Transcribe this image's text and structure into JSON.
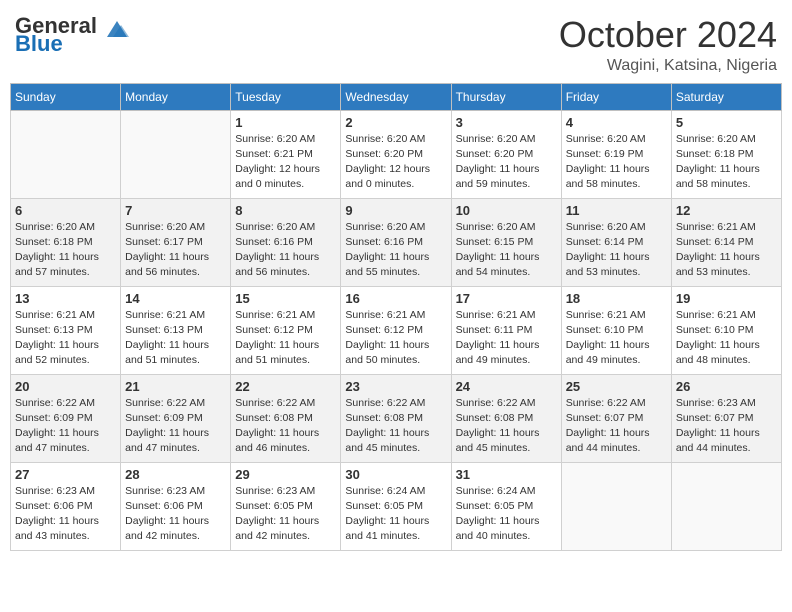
{
  "header": {
    "logo_line1": "General",
    "logo_line2": "Blue",
    "month": "October 2024",
    "location": "Wagini, Katsina, Nigeria"
  },
  "days_of_week": [
    "Sunday",
    "Monday",
    "Tuesday",
    "Wednesday",
    "Thursday",
    "Friday",
    "Saturday"
  ],
  "weeks": [
    [
      {
        "day": "",
        "info": ""
      },
      {
        "day": "",
        "info": ""
      },
      {
        "day": "1",
        "info": "Sunrise: 6:20 AM\nSunset: 6:21 PM\nDaylight: 12 hours and 0 minutes."
      },
      {
        "day": "2",
        "info": "Sunrise: 6:20 AM\nSunset: 6:20 PM\nDaylight: 12 hours and 0 minutes."
      },
      {
        "day": "3",
        "info": "Sunrise: 6:20 AM\nSunset: 6:20 PM\nDaylight: 11 hours and 59 minutes."
      },
      {
        "day": "4",
        "info": "Sunrise: 6:20 AM\nSunset: 6:19 PM\nDaylight: 11 hours and 58 minutes."
      },
      {
        "day": "5",
        "info": "Sunrise: 6:20 AM\nSunset: 6:18 PM\nDaylight: 11 hours and 58 minutes."
      }
    ],
    [
      {
        "day": "6",
        "info": "Sunrise: 6:20 AM\nSunset: 6:18 PM\nDaylight: 11 hours and 57 minutes."
      },
      {
        "day": "7",
        "info": "Sunrise: 6:20 AM\nSunset: 6:17 PM\nDaylight: 11 hours and 56 minutes."
      },
      {
        "day": "8",
        "info": "Sunrise: 6:20 AM\nSunset: 6:16 PM\nDaylight: 11 hours and 56 minutes."
      },
      {
        "day": "9",
        "info": "Sunrise: 6:20 AM\nSunset: 6:16 PM\nDaylight: 11 hours and 55 minutes."
      },
      {
        "day": "10",
        "info": "Sunrise: 6:20 AM\nSunset: 6:15 PM\nDaylight: 11 hours and 54 minutes."
      },
      {
        "day": "11",
        "info": "Sunrise: 6:20 AM\nSunset: 6:14 PM\nDaylight: 11 hours and 53 minutes."
      },
      {
        "day": "12",
        "info": "Sunrise: 6:21 AM\nSunset: 6:14 PM\nDaylight: 11 hours and 53 minutes."
      }
    ],
    [
      {
        "day": "13",
        "info": "Sunrise: 6:21 AM\nSunset: 6:13 PM\nDaylight: 11 hours and 52 minutes."
      },
      {
        "day": "14",
        "info": "Sunrise: 6:21 AM\nSunset: 6:13 PM\nDaylight: 11 hours and 51 minutes."
      },
      {
        "day": "15",
        "info": "Sunrise: 6:21 AM\nSunset: 6:12 PM\nDaylight: 11 hours and 51 minutes."
      },
      {
        "day": "16",
        "info": "Sunrise: 6:21 AM\nSunset: 6:12 PM\nDaylight: 11 hours and 50 minutes."
      },
      {
        "day": "17",
        "info": "Sunrise: 6:21 AM\nSunset: 6:11 PM\nDaylight: 11 hours and 49 minutes."
      },
      {
        "day": "18",
        "info": "Sunrise: 6:21 AM\nSunset: 6:10 PM\nDaylight: 11 hours and 49 minutes."
      },
      {
        "day": "19",
        "info": "Sunrise: 6:21 AM\nSunset: 6:10 PM\nDaylight: 11 hours and 48 minutes."
      }
    ],
    [
      {
        "day": "20",
        "info": "Sunrise: 6:22 AM\nSunset: 6:09 PM\nDaylight: 11 hours and 47 minutes."
      },
      {
        "day": "21",
        "info": "Sunrise: 6:22 AM\nSunset: 6:09 PM\nDaylight: 11 hours and 47 minutes."
      },
      {
        "day": "22",
        "info": "Sunrise: 6:22 AM\nSunset: 6:08 PM\nDaylight: 11 hours and 46 minutes."
      },
      {
        "day": "23",
        "info": "Sunrise: 6:22 AM\nSunset: 6:08 PM\nDaylight: 11 hours and 45 minutes."
      },
      {
        "day": "24",
        "info": "Sunrise: 6:22 AM\nSunset: 6:08 PM\nDaylight: 11 hours and 45 minutes."
      },
      {
        "day": "25",
        "info": "Sunrise: 6:22 AM\nSunset: 6:07 PM\nDaylight: 11 hours and 44 minutes."
      },
      {
        "day": "26",
        "info": "Sunrise: 6:23 AM\nSunset: 6:07 PM\nDaylight: 11 hours and 44 minutes."
      }
    ],
    [
      {
        "day": "27",
        "info": "Sunrise: 6:23 AM\nSunset: 6:06 PM\nDaylight: 11 hours and 43 minutes."
      },
      {
        "day": "28",
        "info": "Sunrise: 6:23 AM\nSunset: 6:06 PM\nDaylight: 11 hours and 42 minutes."
      },
      {
        "day": "29",
        "info": "Sunrise: 6:23 AM\nSunset: 6:05 PM\nDaylight: 11 hours and 42 minutes."
      },
      {
        "day": "30",
        "info": "Sunrise: 6:24 AM\nSunset: 6:05 PM\nDaylight: 11 hours and 41 minutes."
      },
      {
        "day": "31",
        "info": "Sunrise: 6:24 AM\nSunset: 6:05 PM\nDaylight: 11 hours and 40 minutes."
      },
      {
        "day": "",
        "info": ""
      },
      {
        "day": "",
        "info": ""
      }
    ]
  ]
}
